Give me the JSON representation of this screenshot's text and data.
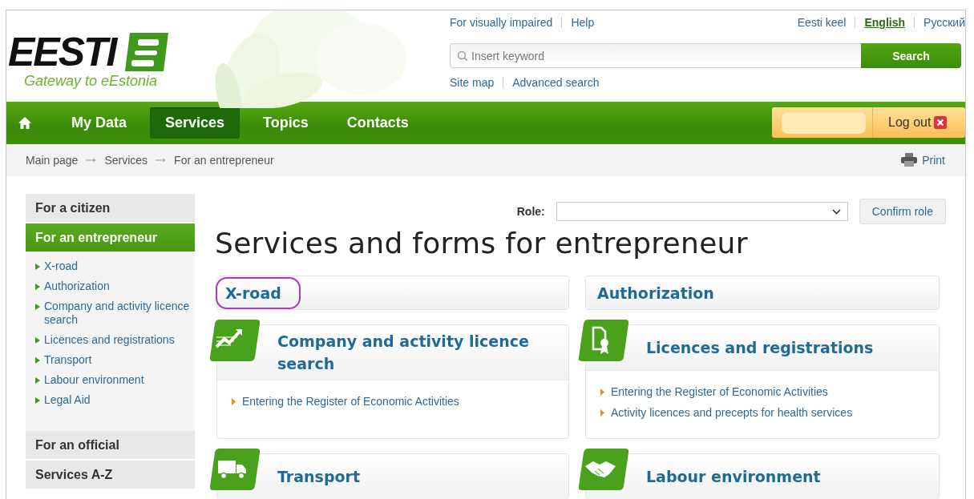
{
  "header": {
    "logo": {
      "wordmark": "EESTI",
      "tagline": "Gateway to eEstonia"
    },
    "top_links": [
      "For visually impaired",
      "Help"
    ],
    "languages": [
      {
        "label": "Eesti keel",
        "selected": false
      },
      {
        "label": "English",
        "selected": true
      },
      {
        "label": "Русский",
        "selected": false
      }
    ],
    "search": {
      "placeholder": "Insert keyword",
      "button": "Search"
    },
    "sub_links": [
      "Site map",
      "Advanced search"
    ]
  },
  "nav": {
    "items": [
      {
        "label": "My Data",
        "selected": false
      },
      {
        "label": "Services",
        "selected": true
      },
      {
        "label": "Topics",
        "selected": false
      },
      {
        "label": "Contacts",
        "selected": false
      }
    ],
    "logout": "Log out"
  },
  "breadcrumb": {
    "items": [
      "Main page",
      "Services",
      "For an entrepreneur"
    ],
    "print": "Print"
  },
  "sidebar": {
    "sections": [
      {
        "label": "For a citizen",
        "selected": false
      },
      {
        "label": "For an entrepreneur",
        "selected": true,
        "children": [
          "X-road",
          "Authorization",
          "Company and activity licence search",
          "Licences and registrations",
          "Transport",
          "Labour environment",
          "Legal Aid"
        ]
      },
      {
        "label": "For an official",
        "selected": false
      },
      {
        "label": "Services A-Z",
        "selected": false
      }
    ]
  },
  "main": {
    "role": {
      "label": "Role:",
      "button": "Confirm role"
    },
    "title": "Services and forms for entrepreneur",
    "cards": [
      {
        "kind": "plain",
        "title": "X-road",
        "circled": true
      },
      {
        "kind": "plain",
        "title": "Authorization",
        "circled": false
      },
      {
        "kind": "icon",
        "title": "Company and activity licence search",
        "circled": false,
        "links": [
          "Entering the Register of Economic Activities"
        ]
      },
      {
        "kind": "icon",
        "title": "Licences and registrations",
        "circled": false,
        "links": [
          "Entering the Register of Economic Activities",
          "Activity licences and precepts for health services"
        ]
      },
      {
        "kind": "icon",
        "title": "Transport",
        "circled": false
      },
      {
        "kind": "icon",
        "title": "Labour environment",
        "circled": false
      }
    ]
  }
}
